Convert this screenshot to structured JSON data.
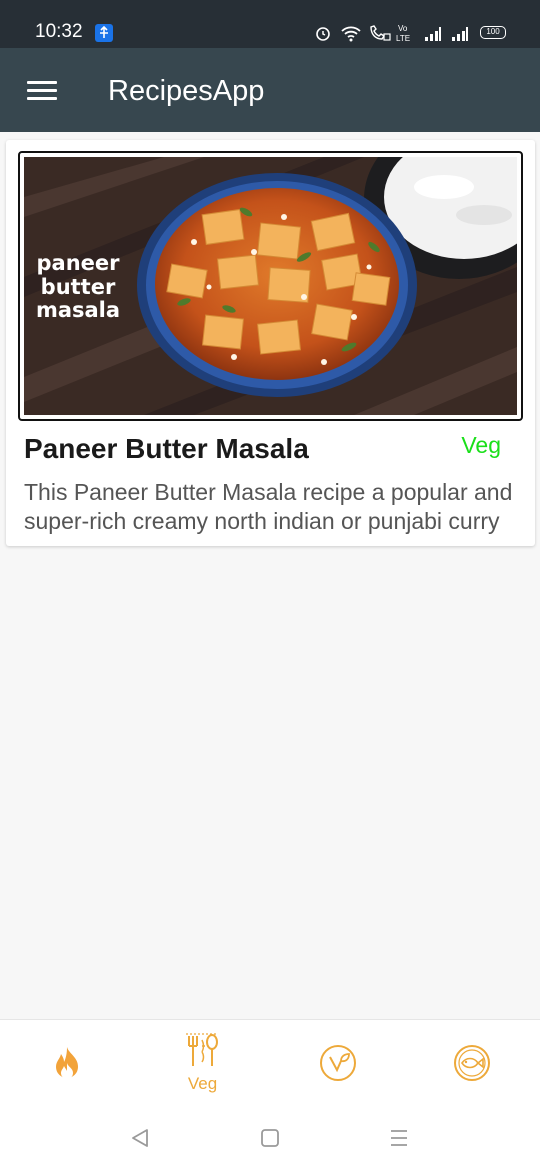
{
  "status_bar": {
    "time": "10:32",
    "battery": "100"
  },
  "app_bar": {
    "title": "RecipesApp"
  },
  "recipes": [
    {
      "image_text": [
        "paneer",
        "butter",
        "masala"
      ],
      "title": "Paneer Butter Masala",
      "badge": "Veg",
      "description": "This Paneer Butter Masala recipe a popular and super-rich creamy north indian or punjabi curry"
    }
  ],
  "bottom_nav": {
    "items": [
      {
        "icon": "flame-icon",
        "label": ""
      },
      {
        "icon": "fork-spoon-icon",
        "label": "Veg"
      },
      {
        "icon": "vegan-leaf-icon",
        "label": ""
      },
      {
        "icon": "fish-icon",
        "label": ""
      }
    ]
  },
  "colors": {
    "app_bar": "#37474f",
    "status_bar": "#272f36",
    "accent": "#eda93a",
    "veg": "#1adf1a"
  }
}
